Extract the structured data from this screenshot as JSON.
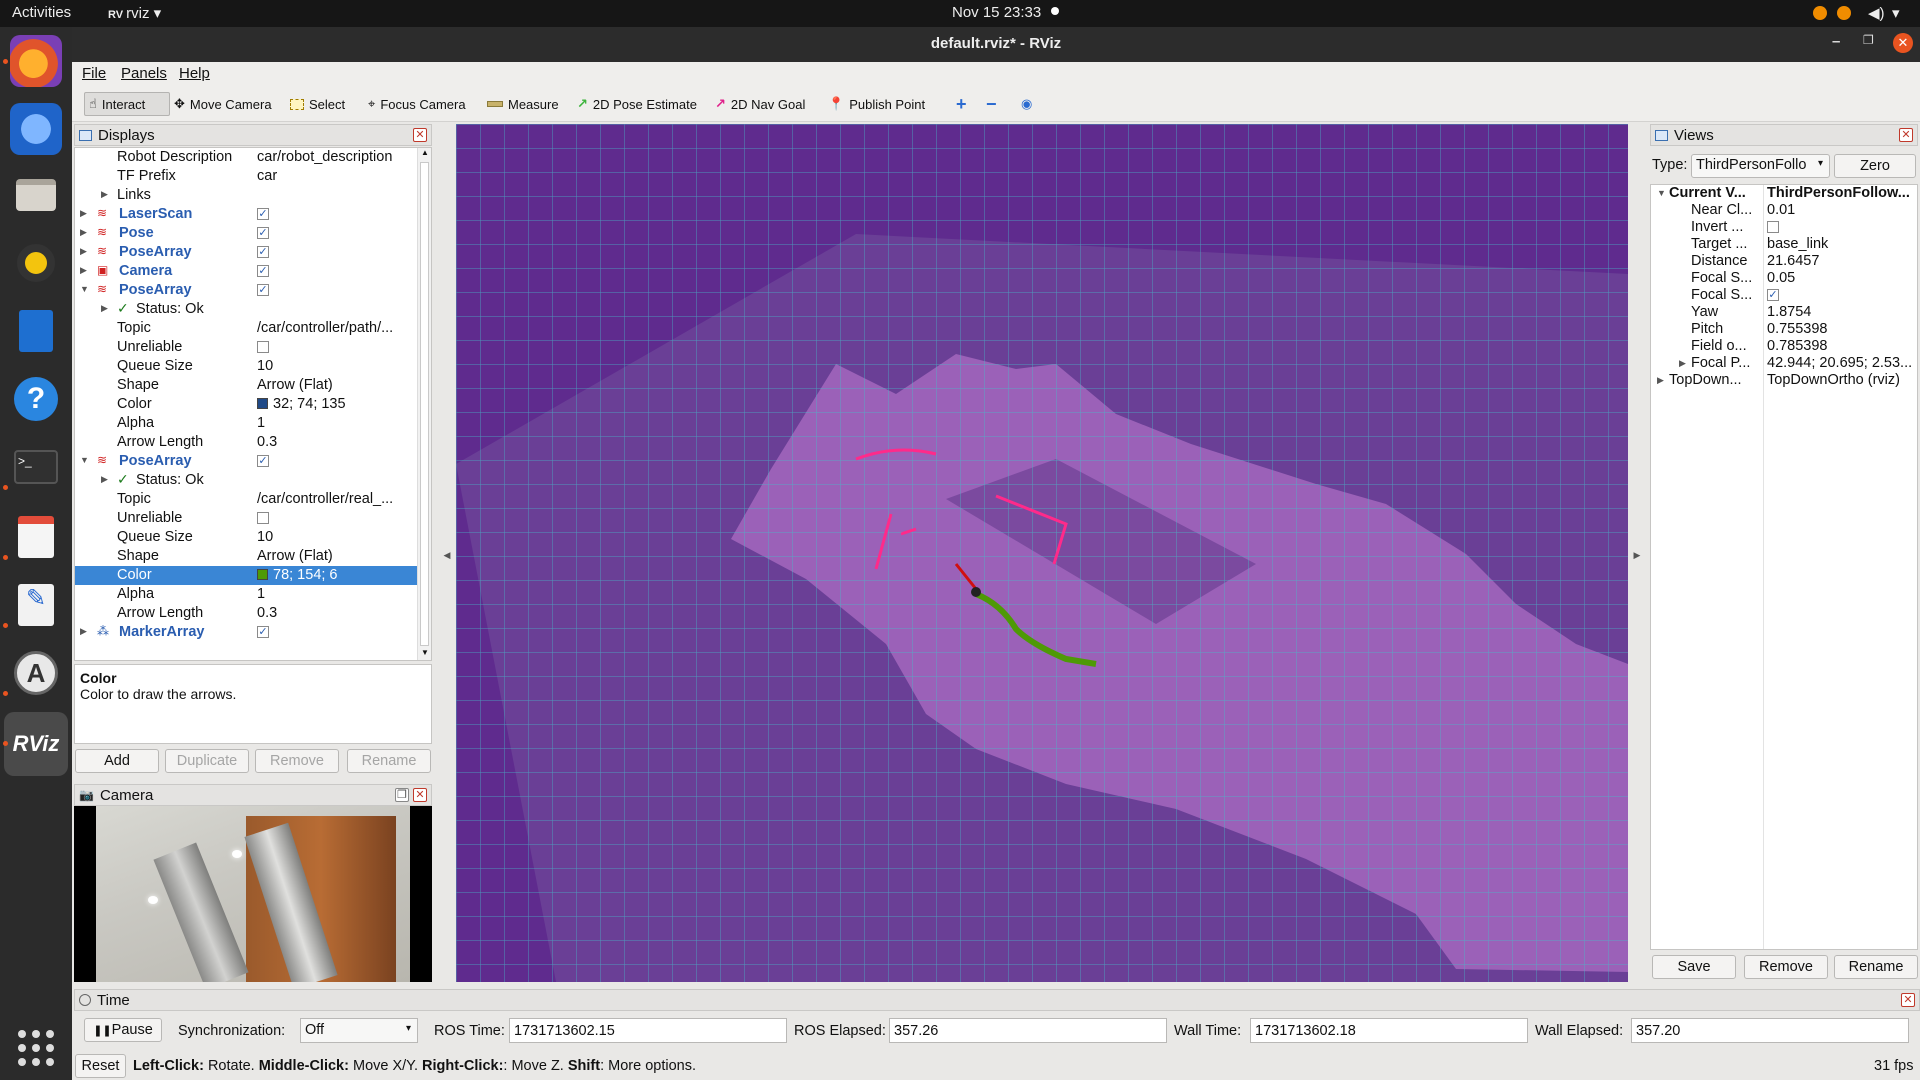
{
  "topbar": {
    "activities": "Activities",
    "app": "rviz",
    "clock": "Nov 15  23:33"
  },
  "dock": {
    "apps": [
      "firefox-icon",
      "thunderbird-icon",
      "files-icon",
      "rhythmbox-icon",
      "writer-icon",
      "help-icon",
      "terminal-icon",
      "reader-icon",
      "text-editor-icon",
      "software-icon",
      "rviz-icon"
    ]
  },
  "window": {
    "title": "default.rviz* - RViz"
  },
  "menu": {
    "file": "File",
    "panels": "Panels",
    "help": "Help"
  },
  "toolbar": {
    "interact": "Interact",
    "move_camera": "Move Camera",
    "select": "Select",
    "focus_camera": "Focus Camera",
    "measure": "Measure",
    "pose_estimate": "2D Pose Estimate",
    "nav_goal": "2D Nav Goal",
    "publish_point": "Publish Point"
  },
  "displays": {
    "title": "Displays",
    "rows": [
      {
        "key": "Robot Description",
        "value": "car/robot_description"
      },
      {
        "key": "TF Prefix",
        "value": "car"
      },
      {
        "key": "Links",
        "value": ""
      },
      {
        "key": "LaserScan",
        "value": "✓"
      },
      {
        "key": "Pose",
        "value": "✓"
      },
      {
        "key": "PoseArray",
        "value": "✓"
      },
      {
        "key": "Camera",
        "value": "✓"
      },
      {
        "key": "PoseArray",
        "value": "✓"
      },
      {
        "key": "Status: Ok",
        "value": ""
      },
      {
        "key": "Topic",
        "value": "/car/controller/path/..."
      },
      {
        "key": "Unreliable",
        "value": ""
      },
      {
        "key": "Queue Size",
        "value": "10"
      },
      {
        "key": "Shape",
        "value": "Arrow (Flat)"
      },
      {
        "key": "Color",
        "value": "32; 74; 135"
      },
      {
        "key": "Alpha",
        "value": "1"
      },
      {
        "key": "Arrow Length",
        "value": "0.3"
      },
      {
        "key": "PoseArray",
        "value": "✓"
      },
      {
        "key": "Status: Ok",
        "value": ""
      },
      {
        "key": "Topic",
        "value": "/car/controller/real_..."
      },
      {
        "key": "Unreliable",
        "value": ""
      },
      {
        "key": "Queue Size",
        "value": "10"
      },
      {
        "key": "Shape",
        "value": "Arrow (Flat)"
      },
      {
        "key": "Color",
        "value": "78; 154; 6"
      },
      {
        "key": "Alpha",
        "value": "1"
      },
      {
        "key": "Arrow Length",
        "value": "0.3"
      },
      {
        "key": "MarkerArray",
        "value": "✓"
      }
    ],
    "help_title": "Color",
    "help_text": "Color to draw the arrows.",
    "add": "Add",
    "duplicate": "Duplicate",
    "remove": "Remove",
    "rename": "Rename",
    "color1": "#204a87",
    "color2": "#4e9a06"
  },
  "camera_panel": {
    "title": "Camera"
  },
  "views": {
    "title": "Views",
    "type_label": "Type:",
    "type_value": "ThirdPersonFollo",
    "zero": "Zero",
    "rows": [
      {
        "key": "Current V...",
        "value": "ThirdPersonFollow..."
      },
      {
        "key": "Near Cl...",
        "value": "0.01"
      },
      {
        "key": "Invert ...",
        "value": ""
      },
      {
        "key": "Target ...",
        "value": "base_link"
      },
      {
        "key": "Distance",
        "value": "21.6457"
      },
      {
        "key": "Focal S...",
        "value": "0.05"
      },
      {
        "key": "Focal S...",
        "value": "✓"
      },
      {
        "key": "Yaw",
        "value": "1.8754"
      },
      {
        "key": "Pitch",
        "value": "0.755398"
      },
      {
        "key": "Field o...",
        "value": "0.785398"
      },
      {
        "key": "Focal P...",
        "value": "42.944; 20.695; 2.53..."
      },
      {
        "key": "TopDown...",
        "value": "TopDownOrtho (rviz)"
      }
    ],
    "save": "Save",
    "remove": "Remove",
    "rename": "Rename"
  },
  "time": {
    "title": "Time",
    "pause": "Pause",
    "sync_label": "Synchronization:",
    "sync_value": "Off",
    "ros_time_label": "ROS Time:",
    "ros_time": "1731713602.15",
    "ros_elapsed_label": "ROS Elapsed:",
    "ros_elapsed": "357.26",
    "wall_time_label": "Wall Time:",
    "wall_time": "1731713602.18",
    "wall_elapsed_label": "Wall Elapsed:",
    "wall_elapsed": "357.20"
  },
  "status": {
    "reset": "Reset",
    "left_click": "Left-Click:",
    "left_click_desc": "Rotate.",
    "middle_click": "Middle-Click:",
    "middle_click_desc": "Move X/Y.",
    "right_click": "Right-Click:",
    "right_click_desc": ": Move Z.",
    "shift": "Shift",
    "shift_desc": ": More options.",
    "fps": "31 fps"
  }
}
